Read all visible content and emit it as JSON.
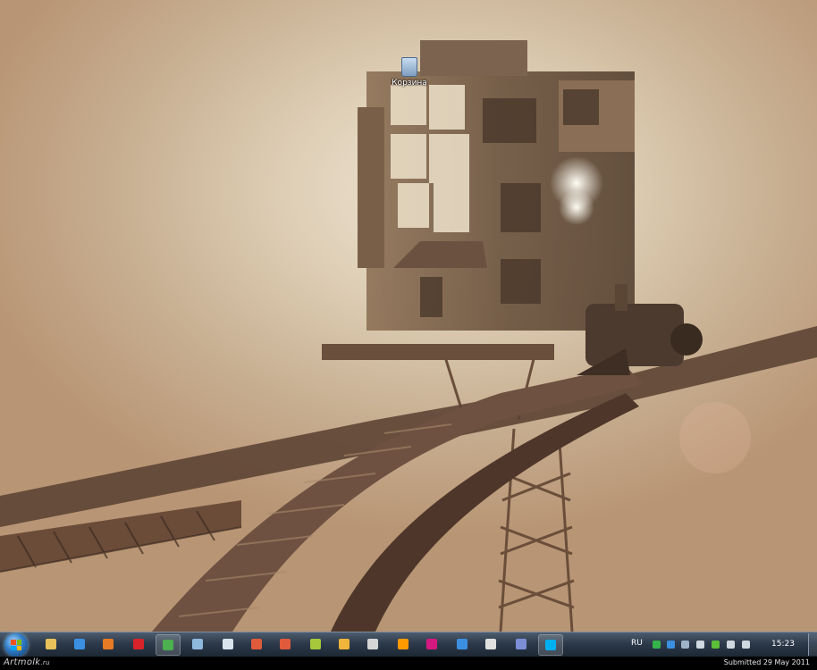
{
  "desktop": {
    "icons": [
      {
        "label": "Корзина",
        "icon": "recycle-bin-icon"
      }
    ],
    "wallpaper": {
      "subject": "steampunk-house-on-railway-bridge",
      "colors": [
        "#efe5d4",
        "#c9b194",
        "#6e5440"
      ]
    }
  },
  "taskbar": {
    "start": {
      "icon": "windows-start-orb-icon"
    },
    "apps": [
      {
        "name": "explorer-icon",
        "color": "#e8c15a",
        "active": false
      },
      {
        "name": "internet-explorer-icon",
        "color": "#3b8fe0",
        "active": false
      },
      {
        "name": "firefox-icon",
        "color": "#e87a25",
        "active": false
      },
      {
        "name": "opera-icon",
        "color": "#d8232a",
        "active": false
      },
      {
        "name": "chrome-icon",
        "color": "#4caf50",
        "active": true
      },
      {
        "name": "document-icon",
        "color": "#8fb8de",
        "active": false
      },
      {
        "name": "notepad-icon",
        "color": "#d9e4ef",
        "active": false
      },
      {
        "name": "gear-app-icon",
        "color": "#e05a3c",
        "active": false
      },
      {
        "name": "flash-app-icon",
        "color": "#e05a3c",
        "active": false
      },
      {
        "name": "butterfly-app-icon",
        "color": "#a6c83a",
        "active": false
      },
      {
        "name": "bolt-app-icon",
        "color": "#f0b43a",
        "active": false
      },
      {
        "name": "calendar-app-icon",
        "color": "#d6d6d6",
        "active": false
      },
      {
        "name": "illustrator-icon",
        "color": "#ff9a00",
        "active": false
      },
      {
        "name": "indesign-icon",
        "color": "#d3197f",
        "active": false
      },
      {
        "name": "photoshop-icon",
        "color": "#3b8fe0",
        "active": false
      },
      {
        "name": "unity-icon",
        "color": "#e0e0e0",
        "active": false
      },
      {
        "name": "media-app-icon",
        "color": "#7c8fd6",
        "active": false
      },
      {
        "name": "skype-icon",
        "color": "#00aff0",
        "active": true
      }
    ],
    "tray": {
      "language": "RU",
      "icons": [
        {
          "name": "shield-tray-icon",
          "color": "#36b34a"
        },
        {
          "name": "update-tray-icon",
          "color": "#3b8fe0"
        },
        {
          "name": "device-tray-icon",
          "color": "#9fb3c8"
        },
        {
          "name": "chat-tray-icon",
          "color": "#cfd8e0"
        },
        {
          "name": "messenger-tray-icon",
          "color": "#5bbf3a"
        },
        {
          "name": "network-tray-icon",
          "color": "#d0d8e0"
        },
        {
          "name": "volume-tray-icon",
          "color": "#d0d8e0"
        }
      ],
      "time": "15:23"
    }
  },
  "footer": {
    "brand": "Artmolk",
    "brand_domain": ".ru",
    "submitted": "Submitted 29 May 2011"
  }
}
